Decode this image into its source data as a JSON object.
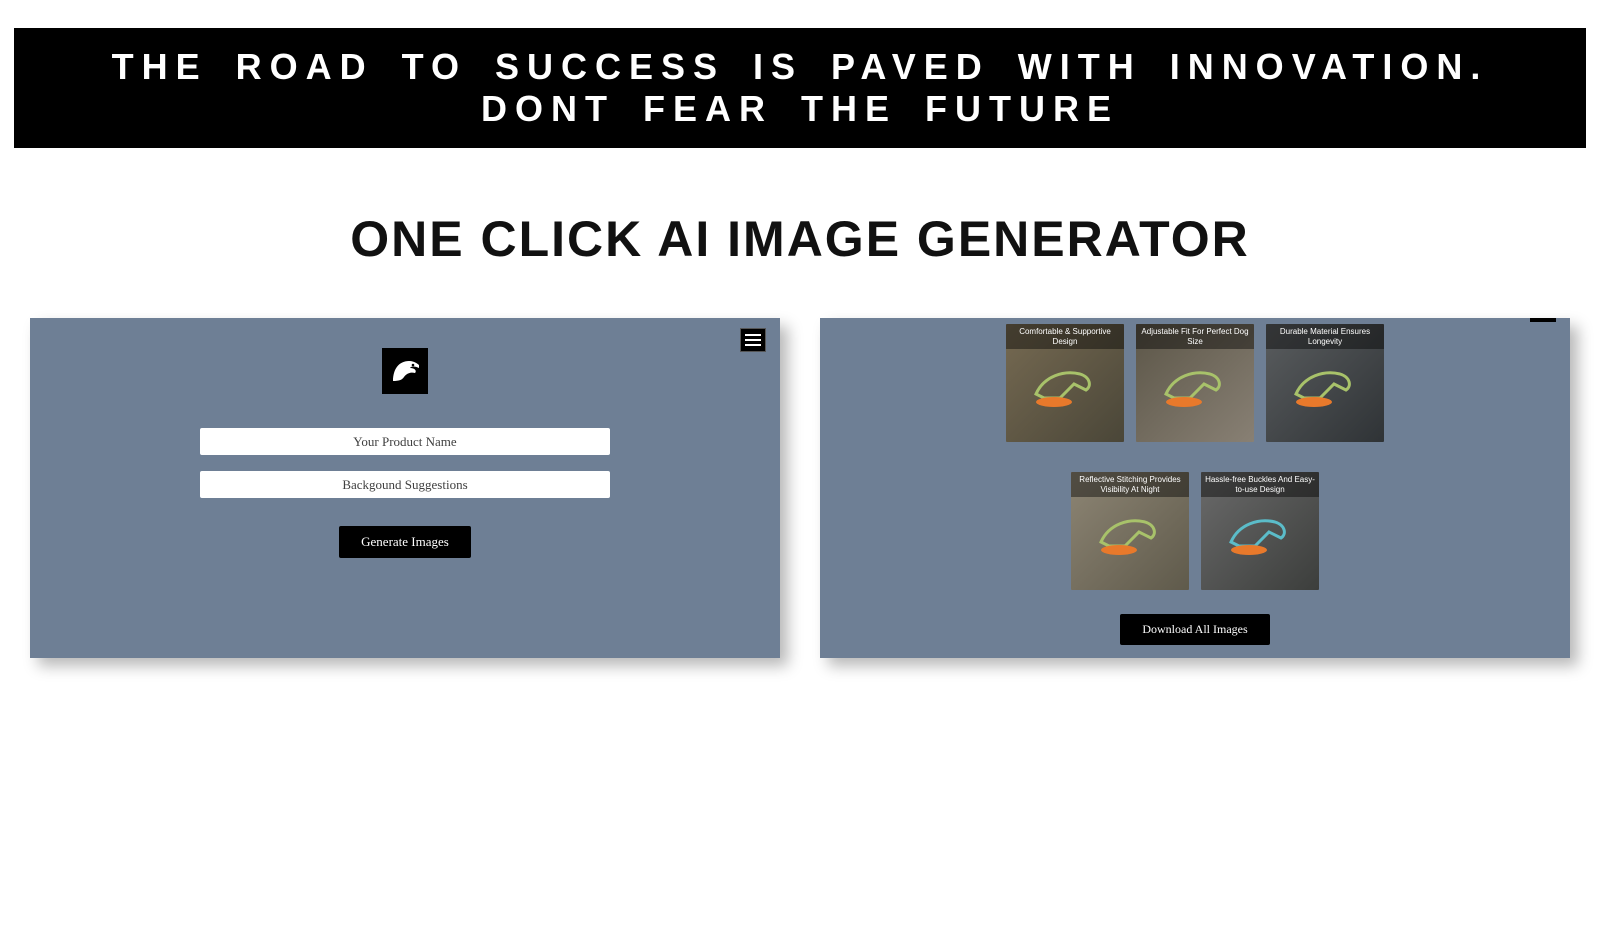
{
  "banner_text": "THE ROAD TO SUCCESS IS PAVED WITH INNOVATION. DONT FEAR THE FUTURE",
  "title": "ONE CLICK AI IMAGE GENERATOR",
  "left_panel": {
    "product_name_placeholder": "Your Product Name",
    "background_placeholder": "Backgound Suggestions",
    "generate_label": "Generate Images"
  },
  "right_panel": {
    "cards_row1": [
      {
        "caption": "Comfortable & Supportive Design"
      },
      {
        "caption": "Adjustable Fit For Perfect Dog Size"
      },
      {
        "caption": "Durable Material Ensures Longevity"
      }
    ],
    "cards_row2": [
      {
        "caption": "Reflective Stitching Provides Visibility At Night"
      },
      {
        "caption": "Hassle-free Buckles And Easy-to-use Design"
      }
    ],
    "download_label": "Download All Images"
  }
}
